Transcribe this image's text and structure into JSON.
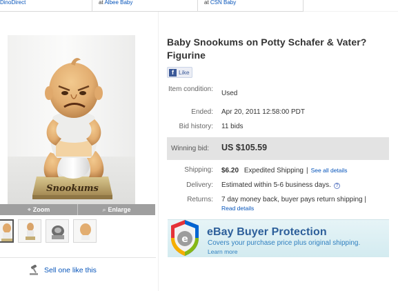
{
  "ads": [
    {
      "prefix": "",
      "name": "DinoDirect"
    },
    {
      "prefix": "at ",
      "name": "Albee Baby"
    },
    {
      "prefix": "at ",
      "name": "CSN Baby"
    }
  ],
  "product": {
    "title": "Baby Snookums on Potty Schafer & Vater? Figurine",
    "figurine_base_text": "Snookums"
  },
  "like_label": "Like",
  "details": {
    "item_condition_label": "Item condition:",
    "item_condition": "Used",
    "ended_label": "Ended:",
    "ended": "Apr 20, 2011 12:58:00 PDT",
    "bid_history_label": "Bid history:",
    "bid_history": "11 bids",
    "winning_bid_label": "Winning bid:",
    "winning_bid": "US $105.59",
    "shipping_label": "Shipping:",
    "shipping_cost": "$6.20",
    "shipping_method": "Expedited Shipping",
    "see_all_details": "See all details",
    "delivery_label": "Delivery:",
    "delivery": "Estimated within 5-6 business days.",
    "returns_label": "Returns:",
    "returns": "7 day money back, buyer pays return shipping |",
    "read_details": "Read details"
  },
  "image_controls": {
    "zoom": "Zoom",
    "enlarge": "Enlarge"
  },
  "thumbnails": [
    "thumb-1",
    "thumb-2",
    "thumb-3",
    "thumb-4"
  ],
  "sell_one": "Sell one like this",
  "buyer_protection": {
    "title": "eBay Buyer Protection",
    "subtitle": "Covers your purchase price plus original shipping.",
    "learn_more": "Learn more"
  },
  "colors": {
    "link": "#0654ba",
    "winning_bid_bg": "#e3e3e3",
    "protection_bg": "#dbeff3"
  }
}
